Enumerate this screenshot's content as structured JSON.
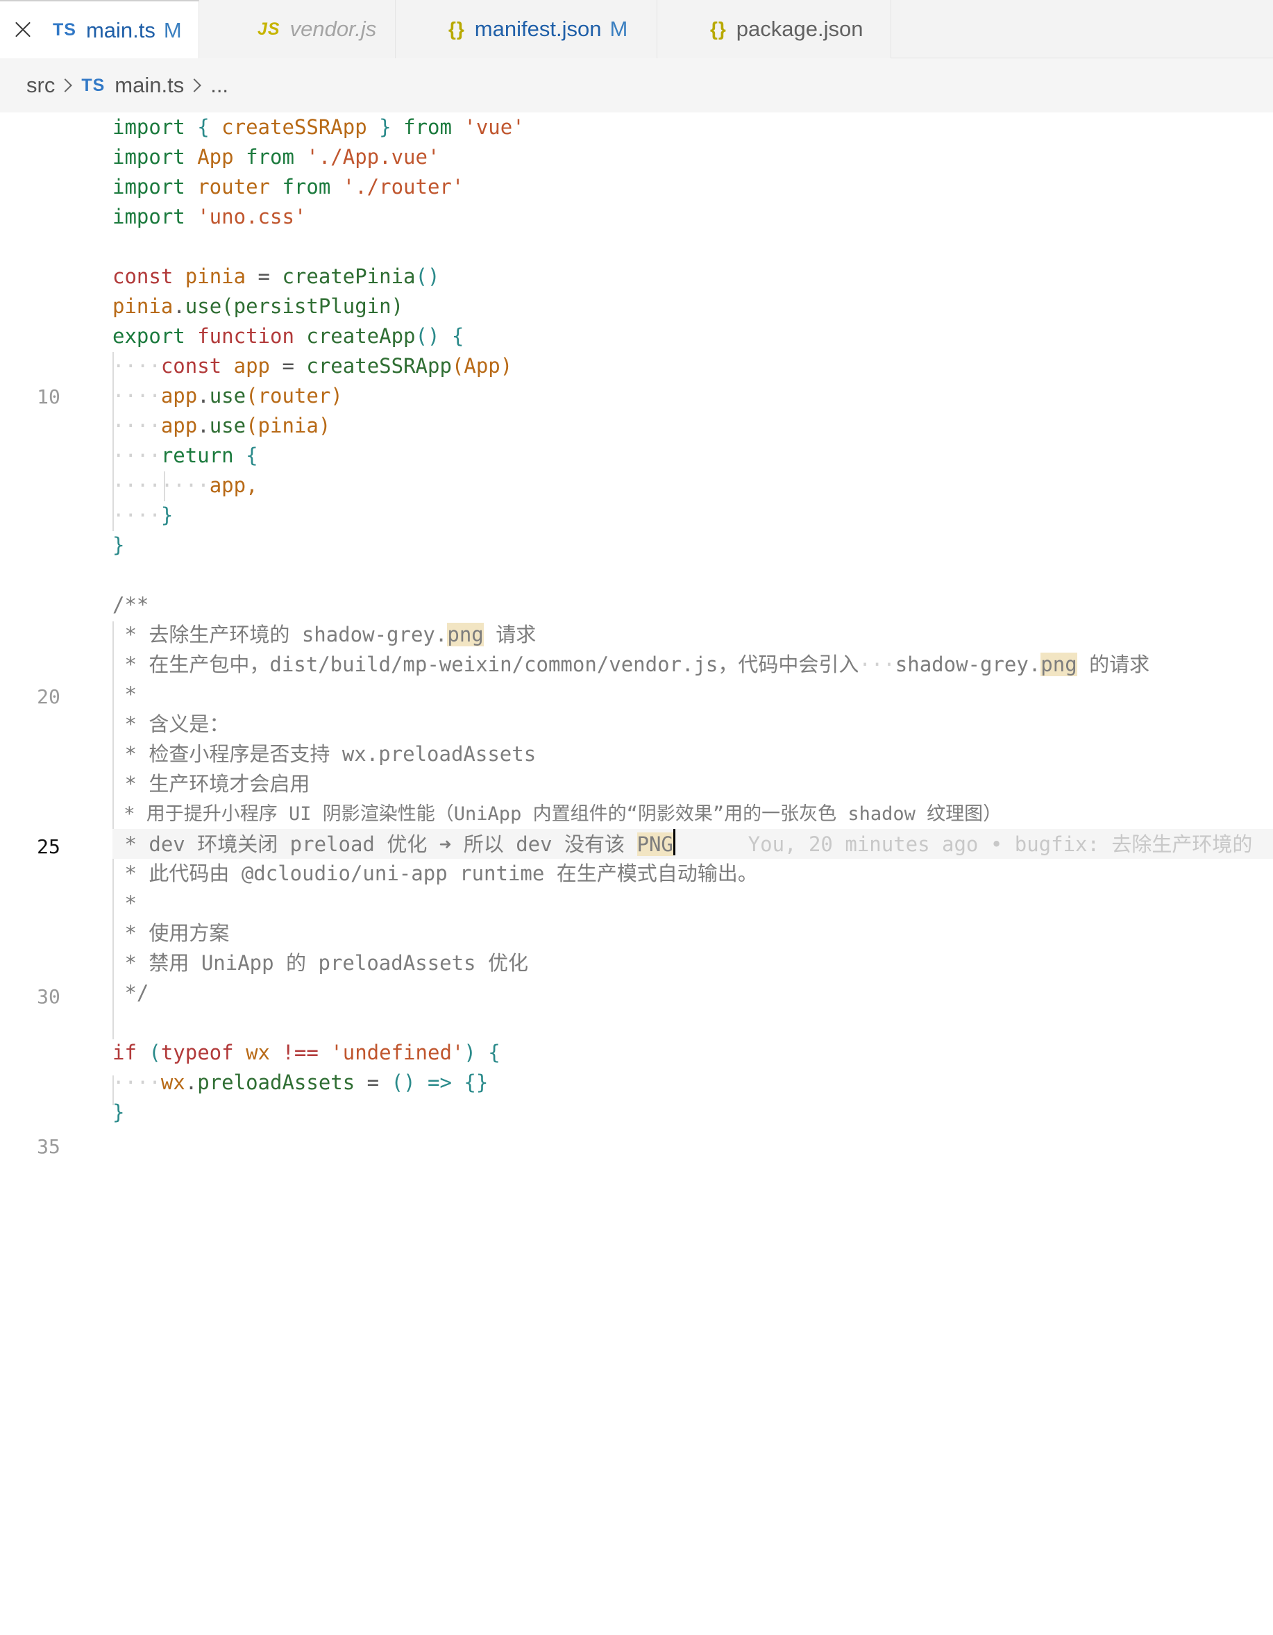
{
  "tabs": [
    {
      "badge": "TS",
      "name": "main.ts",
      "modified": "M"
    },
    {
      "badge": "JS",
      "name": "vendor.js"
    },
    {
      "badge": "{}",
      "name": "manifest.json",
      "modified": "M"
    },
    {
      "badge": "{}",
      "name": "package.json"
    }
  ],
  "breadcrumb": {
    "folder": "src",
    "badge": "TS",
    "file": "main.ts",
    "more": "..."
  },
  "gutter": {
    "n10": "10",
    "n20": "20",
    "n25": "25",
    "n30": "30",
    "n35": "35"
  },
  "code": {
    "l1_kw": "import",
    "l1_a": " { ",
    "l1_b": "createSSRApp",
    "l1_c": " } ",
    "l1_d": "from",
    "l1_e": " 'vue'",
    "l2_kw": "import",
    "l2_b": " App ",
    "l2_d": "from",
    "l2_e": " './App.vue'",
    "l3_kw": "import",
    "l3_b": " router ",
    "l3_d": "from",
    "l3_e": " './router'",
    "l4_kw": "import",
    "l4_e": " 'uno.css'",
    "l6_kw": "const",
    "l6_b": " pinia ",
    "l6_c": "= ",
    "l6_d": "createPinia",
    "l6_e": "()",
    "l7_a": "pinia",
    "l7_b": ".",
    "l7_c": "use",
    "l7_d": "(persistPlugin)",
    "l8_kw": "export",
    "l8_b": " function ",
    "l8_c": "createApp",
    "l8_d": "() {",
    "l9_ws": "····",
    "l9_kw": "const",
    "l9_b": " app ",
    "l9_c": "= ",
    "l9_d": "createSSRApp",
    "l9_e": "(App)",
    "l10_ws": "····",
    "l10_a": "app",
    "l10_b": ".",
    "l10_c": "use",
    "l10_d": "(router)",
    "l11_ws": "····",
    "l11_a": "app",
    "l11_b": ".",
    "l11_c": "use",
    "l11_d": "(pinia)",
    "l12_ws": "····",
    "l12_kw": "return",
    "l12_b": " {",
    "l13_ws": "········",
    "l13_a": "app,",
    "l14_ws": "····",
    "l14_a": "}",
    "l15_a": "}",
    "c17": "/**",
    "c18_a": " * 去除生产环境的 shadow-grey.",
    "c18_m": "png",
    "c18_b": " 请求",
    "c19_a": " * 在生产包中，dist/build/mp-weixin/common/vendor.js，代码中会引入",
    "c19_ws": "···",
    "c19_b": "shadow-grey.",
    "c19_m": "png",
    "c19_c": " 的请求",
    "c20": " *",
    "c21": " * 含义是：",
    "c22": " * 检查小程序是否支持 wx.preloadAssets",
    "c23": " * 生产环境才会启用",
    "c24": " * 用于提升小程序 UI 阴影渲染性能（UniApp 内置组件的“阴影效果”用的一张灰色 shadow 纹理图）",
    "c25_a": " * dev 环境关闭 preload 优化 ➜ 所以 dev 没有该 ",
    "c25_m": "PNG",
    "blame": "      You, 20 minutes ago • bugfix: 去除生产环境的",
    "c26": " * 此代码由 @dcloudio/uni-app runtime 在生产模式自动输出。",
    "c27": " *",
    "c28": " * 使用方案",
    "c29": " * 禁用 UniApp 的 preloadAssets 优化",
    "c30": " */",
    "l32_kw": "if",
    "l32_a": " (",
    "l32_b": "typeof",
    "l32_c": " wx ",
    "l32_d": "!==",
    "l32_e": " 'undefined'",
    "l32_f": ") {",
    "l33_ws": "····",
    "l33_a": "wx",
    "l33_b": ".",
    "l33_c": "preloadAssets",
    "l33_d": " = ",
    "l33_e": "() => {}",
    "l34_a": "}"
  }
}
